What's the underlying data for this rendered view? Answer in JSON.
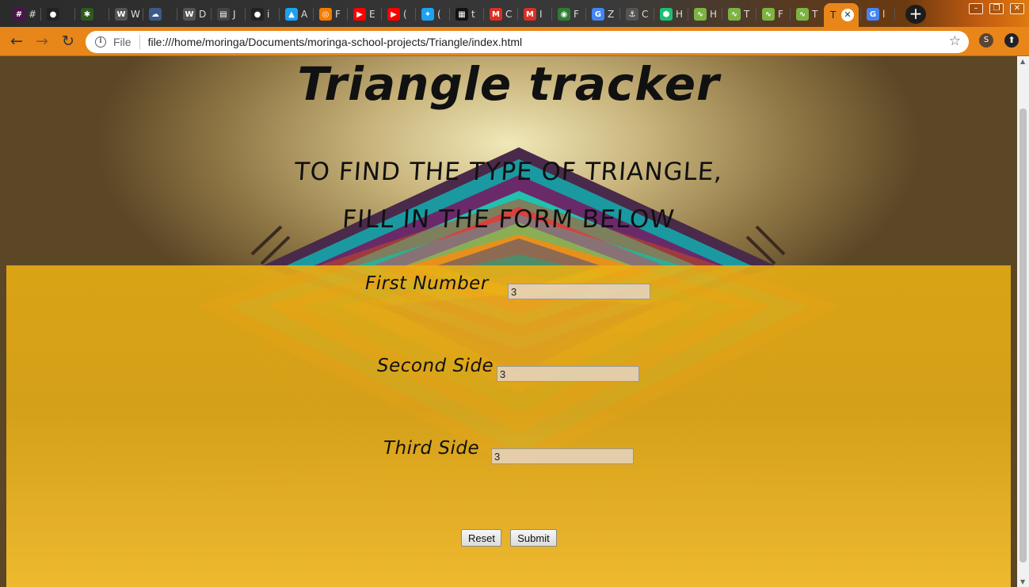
{
  "browser": {
    "tabs": [
      {
        "label": "#",
        "icon": "slack-icon",
        "color": "#4a154b"
      },
      {
        "label": "",
        "icon": "github-icon",
        "color": "#222222"
      },
      {
        "label": "",
        "icon": "palm-tree-icon",
        "color": "#2e5a1c"
      },
      {
        "label": "W",
        "icon": "wordpress-icon",
        "color": "#555555"
      },
      {
        "label": "",
        "icon": "cloud-icon",
        "color": "#3a5a8a"
      },
      {
        "label": "D",
        "icon": "wordpress-icon",
        "color": "#555555"
      },
      {
        "label": "J",
        "icon": "document-icon",
        "color": "#444444"
      },
      {
        "label": "i",
        "icon": "github-icon",
        "color": "#222222"
      },
      {
        "label": "A",
        "icon": "graduation-cap-icon",
        "color": "#1da1f2"
      },
      {
        "label": "F",
        "icon": "target-icon",
        "color": "#f57c00"
      },
      {
        "label": "E",
        "icon": "youtube-icon",
        "color": "#ff0000"
      },
      {
        "label": "(",
        "icon": "youtube-icon",
        "color": "#ff0000"
      },
      {
        "label": "(",
        "icon": "twitter-icon",
        "color": "#1da1f2"
      },
      {
        "label": "t",
        "icon": "qr-icon",
        "color": "#111111"
      },
      {
        "label": "C",
        "icon": "gmail-icon",
        "color": "#d93025"
      },
      {
        "label": "I",
        "icon": "gmail-icon",
        "color": "#d93025"
      },
      {
        "label": "F",
        "icon": "nvidia-icon",
        "color": "#2e7d32"
      },
      {
        "label": "Z",
        "icon": "google-icon",
        "color": "#4285f4"
      },
      {
        "label": "C",
        "icon": "anchor-icon",
        "color": "#555555"
      },
      {
        "label": "H",
        "icon": "hexagon-icon",
        "color": "#1dbf73"
      },
      {
        "label": "H",
        "icon": "chart-icon",
        "color": "#7cb342"
      },
      {
        "label": "T",
        "icon": "chart-icon",
        "color": "#7cb342"
      },
      {
        "label": "F",
        "icon": "chart-icon",
        "color": "#7cb342"
      },
      {
        "label": "T",
        "icon": "chart-icon",
        "color": "#7cb342"
      },
      {
        "label": "T",
        "icon": "",
        "color": "#e8861a",
        "active": true
      },
      {
        "label": "l",
        "icon": "google-icon",
        "color": "#4285f4"
      }
    ],
    "new_tab": "+",
    "window": {
      "minimize": "–",
      "maximize": "❐",
      "close": "✕"
    },
    "address": {
      "scheme_label": "File",
      "url": "file:///home/moringa/Documents/moringa-school-projects/Triangle/index.html"
    },
    "avatar_letter": "S",
    "accent_color": "#e8861a"
  },
  "page": {
    "title": "Triangle tracker",
    "subtitle_line1": "TO FIND THE TYPE OF TRIANGLE,",
    "subtitle_line2": "FILL IN THE FORM BELOW",
    "fields": [
      {
        "label": "First Number",
        "value": "3"
      },
      {
        "label": "Second Side",
        "value": "3"
      },
      {
        "label": "Third Side",
        "value": "3"
      }
    ],
    "reset_label": "Reset",
    "submit_label": "Submit",
    "panel_color": "#e8aa1a"
  }
}
